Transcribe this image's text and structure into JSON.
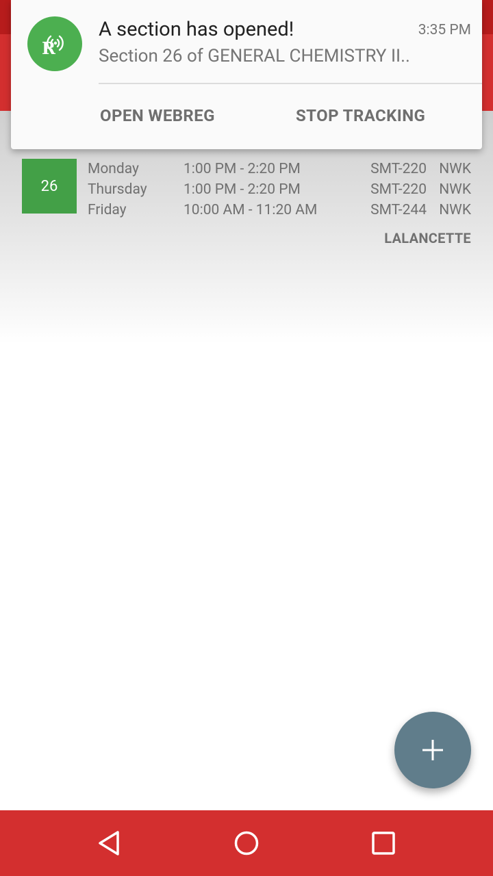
{
  "notification": {
    "title": "A section has opened!",
    "time": "3:35 PM",
    "text": "Section 26 of GENERAL CHEMISTRY II..",
    "app_icon": "radar-r-icon",
    "actions": [
      {
        "label": "OPEN WEBREG"
      },
      {
        "label": "STOP TRACKING"
      }
    ]
  },
  "section": {
    "number": "26",
    "meetings": [
      {
        "day": "Monday",
        "time": "1:00 PM - 2:20 PM",
        "room": "SMT-220",
        "campus": "NWK"
      },
      {
        "day": "Thursday",
        "time": "1:00 PM - 2:20 PM",
        "room": "SMT-220",
        "campus": "NWK"
      },
      {
        "day": "Friday",
        "time": "10:00 AM - 11:20 AM",
        "room": "SMT-244",
        "campus": "NWK"
      }
    ],
    "instructor": "LALANCETTE"
  },
  "fab": {
    "icon": "plus-icon"
  },
  "nav": {
    "back_icon": "back-triangle-icon",
    "home_icon": "home-circle-icon",
    "recent_icon": "recent-apps-square-icon"
  },
  "colors": {
    "primary_dark": "#b71c1c",
    "primary": "#d32f2f",
    "section_badge": "#43a047",
    "notif_icon_bg": "#4caf50",
    "fab": "#607d8b"
  }
}
